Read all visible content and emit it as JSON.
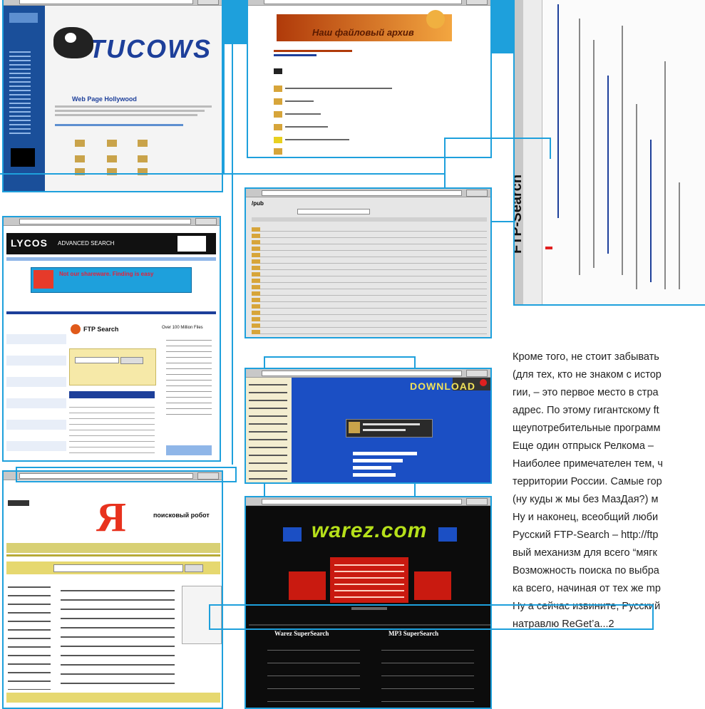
{
  "colors": {
    "accent": "#1ea0dc",
    "text": "#222222"
  },
  "screenshots": {
    "tucows": {
      "brand": "TUCOWS",
      "headline": "Web Page Hollywood"
    },
    "ftp_archive": {
      "title": "Наш файловый архив"
    },
    "ftp_search": {
      "label": "FTP-Search"
    },
    "lycos": {
      "brand": "LYCOS",
      "subtitle": "ADVANCED SEARCH",
      "section": "FTP Search",
      "count": "Over 100 Million Files",
      "banner": "Not our shareware. Finding is easy"
    },
    "ipub": {
      "title": "/pub"
    },
    "download": {
      "brand": "DOWNLOAD"
    },
    "yandex": {
      "logo": "Я",
      "tagline": "поисковый робот"
    },
    "warez": {
      "brand": "warez.com",
      "col1": "Warez SuperSearch",
      "col2": "MP3 SuperSearch"
    }
  },
  "article": {
    "lines": [
      "Кроме того, не стоит забывать",
      "(для тех, кто не знаком с истор",
      "гии, – это первое место в стра",
      "адрес. По этому гигантскому ft",
      "щеупотребительные программ",
      "Еще один отпрыск Релкома – ",
      "Наиболее примечателен тем, ч",
      "территории России. Самые гор",
      "(ну куды ж мы без МазДая?) м",
      "Ну и наконец, всеобщий люби",
      "Русский FTP-Search – http://ftp",
      "вый механизм для всего “мягк",
      "Возможность поиска по выбра",
      "ка всего, начиная от тех же mp",
      "Ну а сейчас извините, Русский",
      "натравлю ReGet’a...2"
    ]
  }
}
